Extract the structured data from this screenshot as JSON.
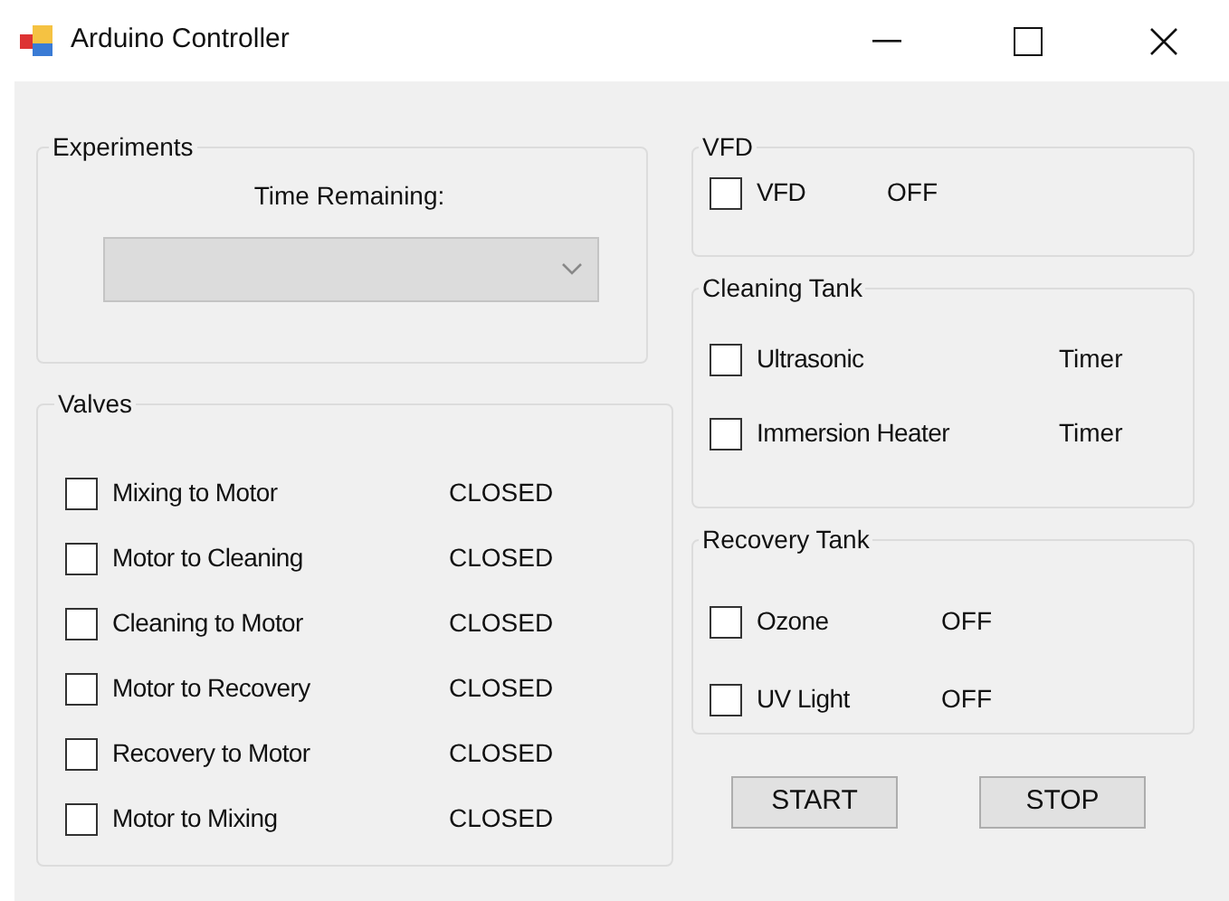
{
  "window": {
    "title": "Arduino Controller"
  },
  "experiments": {
    "title": "Experiments",
    "label": "Time Remaining:",
    "combo": {
      "disabled": true
    }
  },
  "valves": {
    "title": "Valves",
    "items": [
      {
        "label": "Mixing to Motor",
        "checked": false,
        "status": "CLOSED"
      },
      {
        "label": "Motor to Cleaning",
        "checked": false,
        "status": "CLOSED"
      },
      {
        "label": "Cleaning to Motor",
        "checked": false,
        "status": "CLOSED"
      },
      {
        "label": "Motor to Recovery",
        "checked": false,
        "status": "CLOSED"
      },
      {
        "label": "Recovery to Motor",
        "checked": false,
        "status": "CLOSED"
      },
      {
        "label": "Motor to Mixing",
        "checked": false,
        "status": "CLOSED"
      }
    ]
  },
  "vfd": {
    "title": "VFD",
    "items": [
      {
        "label": "VFD",
        "checked": false,
        "status": "OFF"
      }
    ]
  },
  "cleaning_tank": {
    "title": "Cleaning Tank",
    "items": [
      {
        "label": "Ultrasonic",
        "checked": false,
        "status": "Timer"
      },
      {
        "label": "Immersion Heater",
        "checked": false,
        "status": "Timer"
      }
    ]
  },
  "recovery_tank": {
    "title": "Recovery Tank",
    "items": [
      {
        "label": "Ozone",
        "checked": false,
        "status": "OFF"
      },
      {
        "label": "UV Light",
        "checked": false,
        "status": "OFF"
      }
    ]
  },
  "buttons": [
    "START",
    "STOP"
  ]
}
